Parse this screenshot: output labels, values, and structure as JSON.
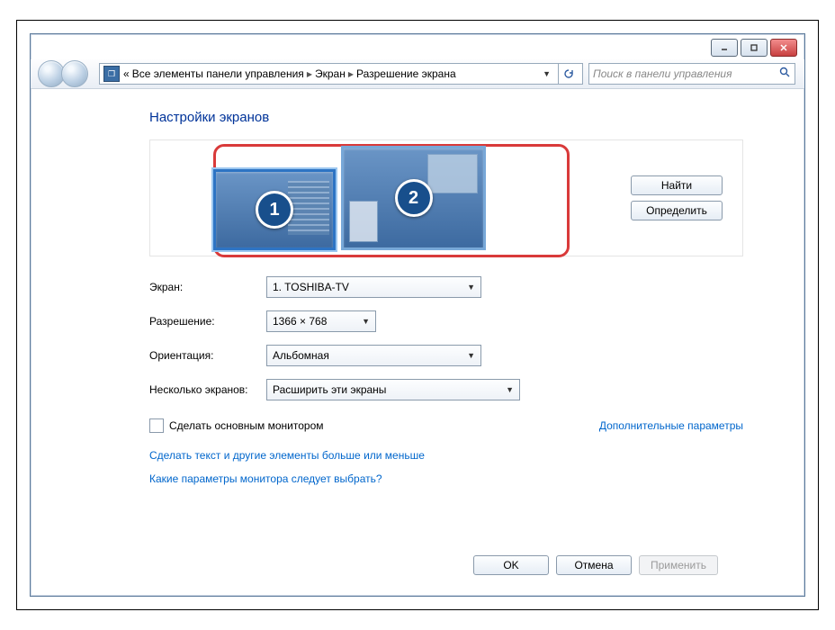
{
  "breadcrumb": {
    "prefix": "«",
    "item1": "Все элементы панели управления",
    "item2": "Экран",
    "item3": "Разрешение экрана"
  },
  "search": {
    "placeholder": "Поиск в панели управления"
  },
  "heading": "Настройки экранов",
  "monitors": {
    "mon1_num": "1",
    "mon2_num": "2"
  },
  "arrange_buttons": {
    "find": "Найти",
    "identify": "Определить"
  },
  "form": {
    "display_label": "Экран:",
    "display_value": "1. TOSHIBA-TV",
    "resolution_label": "Разрешение:",
    "resolution_value": "1366 × 768",
    "orientation_label": "Ориентация:",
    "orientation_value": "Альбомная",
    "multi_label": "Несколько экранов:",
    "multi_value": "Расширить эти экраны"
  },
  "checkbox": {
    "label": "Сделать основным монитором"
  },
  "advanced_link": "Дополнительные параметры",
  "help_links": {
    "text_size": "Сделать текст и другие элементы больше или меньше",
    "which_params": "Какие параметры монитора следует выбрать?"
  },
  "footer": {
    "ok": "OK",
    "cancel": "Отмена",
    "apply": "Применить"
  }
}
